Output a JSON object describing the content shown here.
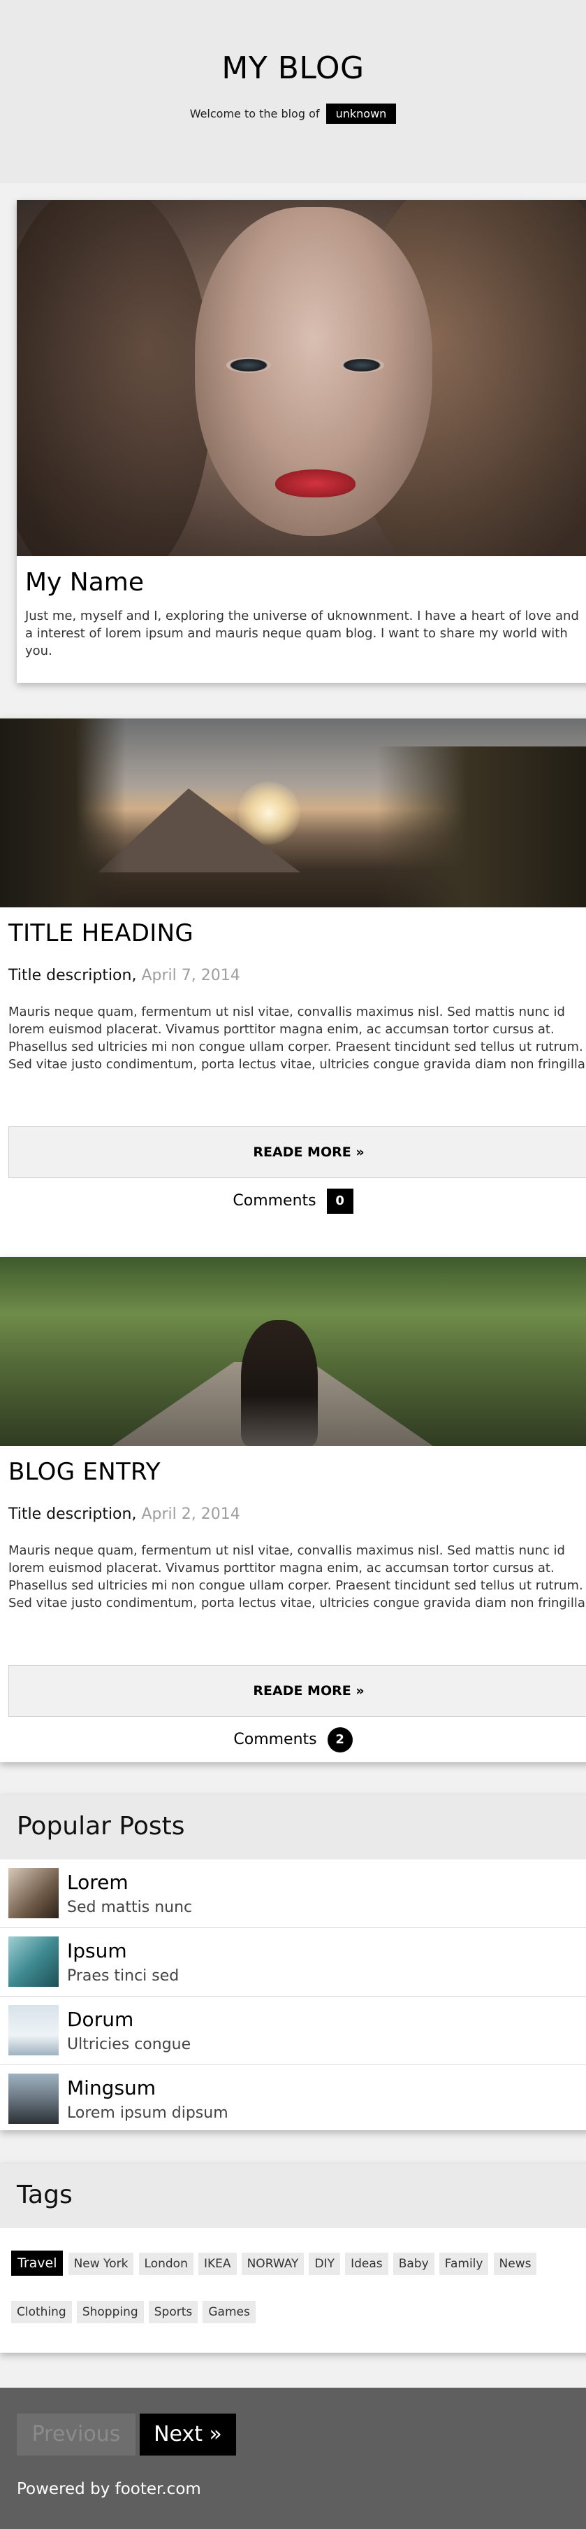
{
  "header": {
    "title": "MY BLOG",
    "welcome_text": "Welcome to the blog of",
    "username": "unknown"
  },
  "profile": {
    "name": "My Name",
    "bio": "Just me, myself and I, exploring the universe of uknownment. I have a heart of love and a interest of lorem ipsum and mauris neque quam blog. I want to share my world with you."
  },
  "posts": [
    {
      "title": "TITLE HEADING",
      "description": "Title description,",
      "date": "April 7, 2014",
      "body": "Mauris neque quam, fermentum ut nisl vitae, convallis maximus nisl. Sed mattis nunc id lorem euismod placerat. Vivamus porttitor magna enim, ac accumsan tortor cursus at. Phasellus sed ultricies mi non congue ullam corper. Praesent tincidunt sed tellus ut rutrum. Sed vitae justo condimentum, porta lectus vitae, ultricies congue gravida diam non fringilla.",
      "read_more": "READE MORE »",
      "comments_label": "Comments",
      "comments_count": "0"
    },
    {
      "title": "BLOG ENTRY",
      "description": "Title description,",
      "date": "April 2, 2014",
      "body": "Mauris neque quam, fermentum ut nisl vitae, convallis maximus nisl. Sed mattis nunc id lorem euismod placerat. Vivamus porttitor magna enim, ac accumsan tortor cursus at. Phasellus sed ultricies mi non congue ullam corper. Praesent tincidunt sed tellus ut rutrum. Sed vitae justo condimentum, porta lectus vitae, ultricies congue gravida diam non fringilla.",
      "read_more": "READE MORE »",
      "comments_label": "Comments",
      "comments_count": "2"
    }
  ],
  "popular": {
    "heading": "Popular Posts",
    "items": [
      {
        "title": "Lorem",
        "subtitle": "Sed mattis nunc"
      },
      {
        "title": "Ipsum",
        "subtitle": "Praes tinci sed"
      },
      {
        "title": "Dorum",
        "subtitle": "Ultricies congue"
      },
      {
        "title": "Mingsum",
        "subtitle": "Lorem ipsum dipsum"
      }
    ]
  },
  "tags": {
    "heading": "Tags",
    "items": [
      "Travel",
      "New York",
      "London",
      "IKEA",
      "NORWAY",
      "DIY",
      "Ideas",
      "Baby",
      "Family",
      "News",
      "Clothing",
      "Shopping",
      "Sports",
      "Games"
    ],
    "active": "Travel"
  },
  "footer": {
    "previous": "Previous",
    "next": "Next »",
    "powered_by": "Powered by footer.com"
  },
  "colors": {
    "header_bg": "#eaeaea",
    "accent": "#000000",
    "date_gray": "#9e9e9e",
    "footer_bg": "#5f5f5f"
  }
}
